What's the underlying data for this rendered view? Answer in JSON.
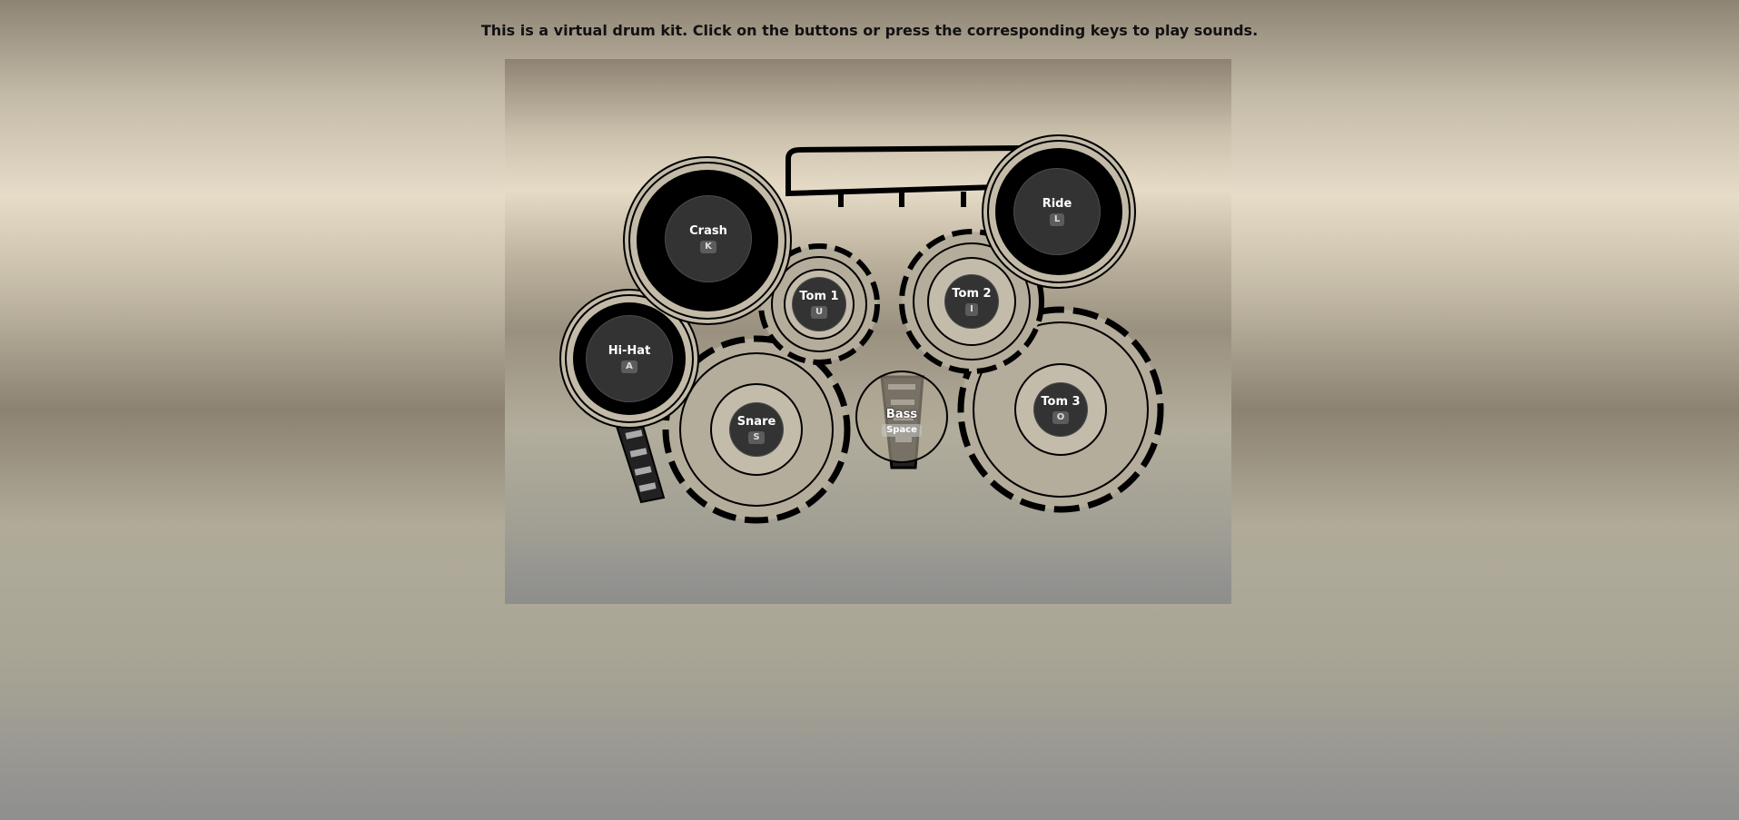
{
  "instructions": "This is a virtual drum kit. Click on the buttons or press the corresponding keys to play sounds.",
  "drums": {
    "crash": {
      "label": "Crash",
      "key": "K"
    },
    "ride": {
      "label": "Ride",
      "key": "L"
    },
    "tom1": {
      "label": "Tom 1",
      "key": "U"
    },
    "tom2": {
      "label": "Tom 2",
      "key": "I"
    },
    "hihat": {
      "label": "Hi-Hat",
      "key": "A"
    },
    "snare": {
      "label": "Snare",
      "key": "S"
    },
    "bass": {
      "label": "Bass",
      "key": "Space"
    },
    "tom3": {
      "label": "Tom 3",
      "key": "O"
    }
  },
  "colors": {
    "pad": "#333333",
    "outline": "#000000",
    "shell": "#b5ad9b"
  }
}
